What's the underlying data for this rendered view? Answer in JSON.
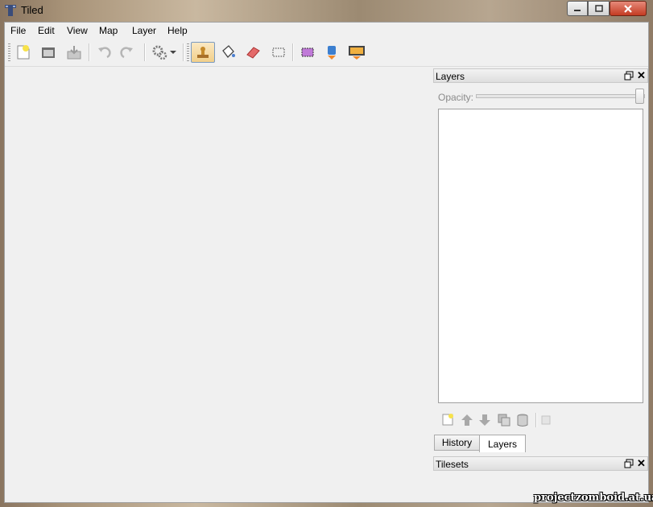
{
  "window": {
    "title": "Tiled"
  },
  "menu": {
    "items": [
      "File",
      "Edit",
      "View",
      "Map",
      "Layer",
      "Help"
    ]
  },
  "toolbar": {
    "tools": [
      "new-file-icon",
      "open-file-icon",
      "save-icon",
      "undo-icon",
      "redo-icon",
      "commands-icon",
      "stamp-brush-icon",
      "bucket-fill-icon",
      "eraser-icon",
      "rect-select-icon",
      "select-same-tile-icon",
      "stamp-layer-icon",
      "image-layer-icon"
    ],
    "active_tool": "stamp-brush-icon"
  },
  "layers_dock": {
    "title": "Layers",
    "opacity_label": "Opacity:",
    "opacity_value": 1.0
  },
  "bottom_tabs": {
    "history": "History",
    "layers": "Layers",
    "selected": "Layers"
  },
  "tilesets_dock": {
    "title": "Tilesets"
  },
  "watermark": {
    "text": "projectzomboid.at.ua"
  },
  "colors": {
    "accent_active": "#f1cf8a",
    "close_button": "#c43b22"
  }
}
